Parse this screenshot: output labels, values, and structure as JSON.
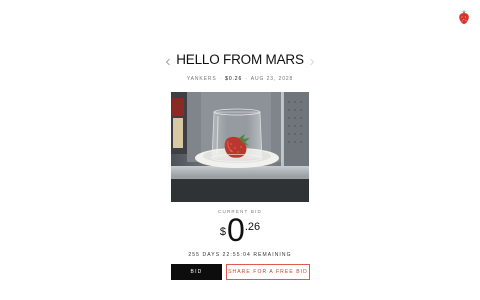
{
  "header": {
    "logo_icon": "strawberry-icon"
  },
  "item": {
    "title": "HELLO FROM MARS",
    "team": "YANKERS",
    "price": "$0.26",
    "date": "AUG 23, 2028",
    "photo_icon": "strawberry-under-glass-photo"
  },
  "nav": {
    "prev_icon": "chevron-left-icon",
    "next_icon": "chevron-right-icon"
  },
  "bid": {
    "label": "CURRENT BID",
    "currency": "$",
    "whole": "0",
    "cents": ".26",
    "remaining": "255 DAYS 22:55:04 REMAINING"
  },
  "actions": {
    "bid_label": "BID",
    "share_label": "SHARE FOR A FREE BID"
  },
  "colors": {
    "accent": "#d83a2e",
    "dark_button": "#0d0d0d"
  }
}
